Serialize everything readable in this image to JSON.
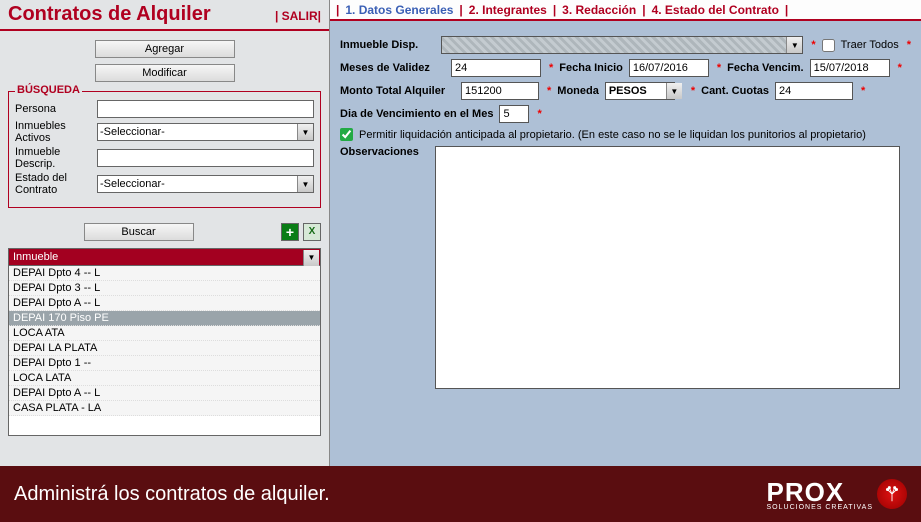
{
  "left": {
    "title": "Contratos de Alquiler",
    "salir": "| SALIR|",
    "agregar": "Agregar",
    "modificar": "Modificar",
    "busqueda_legend": "BÚSQUEDA",
    "labels": {
      "persona": "Persona",
      "inm_activos": "Inmuebles Activos",
      "inm_descrip": "Inmueble Descrip.",
      "estado": "Estado del Contrato"
    },
    "select_placeholder": "-Seleccionar-",
    "buscar": "Buscar",
    "list_header": "Inmueble",
    "list": [
      "DEPAI                                     Dpto 4 -- L",
      "DEPAI                                     Dpto 3 -- L",
      "DEPAI                                      Dpto A -- L",
      "DEPAI                                   170 Piso PE",
      "LOCA                                     ATA",
      "DEPAI                                    LA PLATA",
      "DEPAI                                     Dpto 1 --",
      "LOCA                                    LATA",
      "DEPAI                                    Dpto A -- L",
      "CASA                                    PLATA - LA"
    ],
    "list_selected_index": 3
  },
  "tabs": {
    "t1": "1. Datos Generales",
    "t2": "2. Integrantes",
    "t3": "3. Redacción",
    "t4": "4. Estado del Contrato"
  },
  "form": {
    "inmueble_disp_label": "Inmueble Disp.",
    "traer_todos": "Traer Todos",
    "meses_label": "Meses de Validez",
    "meses_val": "24",
    "fecha_inicio_label": "Fecha Inicio",
    "fecha_inicio_val": "16/07/2016",
    "fecha_venc_label": "Fecha Vencim.",
    "fecha_venc_val": "15/07/2018",
    "monto_label": "Monto Total Alquiler",
    "monto_val": "151200",
    "moneda_label": "Moneda",
    "moneda_val": "PESOS",
    "cuotas_label": "Cant. Cuotas",
    "cuotas_val": "24",
    "dia_venc_label": "Dia de Vencimiento en el Mes",
    "dia_venc_val": "5",
    "permitir_label": "Permitir liquidación anticipada al propietario. (En este caso no se le liquidan los punitorios al propietario)",
    "obs_label": "Observaciones"
  },
  "banner": {
    "text": "Administrá los contratos de alquiler.",
    "logo_text": "PROX",
    "logo_sub": "SOLUCIONES CREATIVAS"
  },
  "glyph": {
    "asterisk": "*",
    "down": "▼",
    "plus": "+",
    "x": "X",
    "pipe": " | "
  }
}
